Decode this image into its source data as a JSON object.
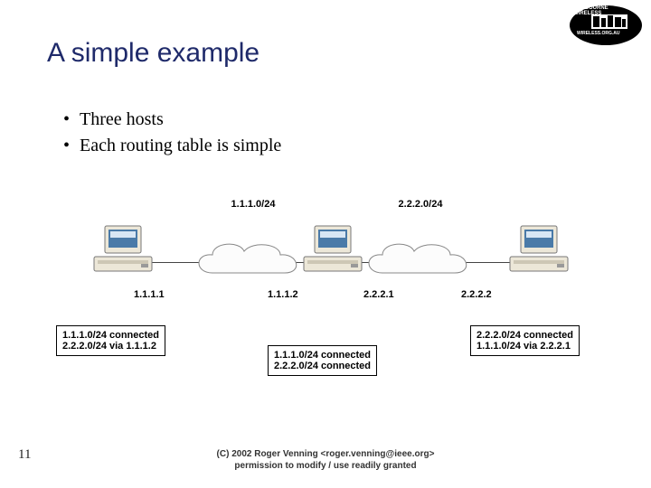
{
  "title": "A simple example",
  "bullets": [
    "Three hosts",
    "Each routing table is simple"
  ],
  "networks": {
    "left": "1.1.1.0/24",
    "right": "2.2.2.0/24"
  },
  "hosts": {
    "a": {
      "ip": "1.1.1.1",
      "route1": "1.1.1.0/24 connected",
      "route2": "2.2.2.0/24 via 1.1.1.2"
    },
    "b": {
      "ip_left": "1.1.1.2",
      "ip_right": "2.2.2.1",
      "route1": "1.1.1.0/24  connected",
      "route2": "2.2.2.0/24  connected"
    },
    "c": {
      "ip": "2.2.2.2",
      "route1": "2.2.2.0/24 connected",
      "route2": "1.1.1.0/24 via 2.2.2.1"
    }
  },
  "footer": {
    "line1": "(C) 2002 Roger Venning <roger.venning@ieee.org>",
    "line2": "permission to modify / use readily granted"
  },
  "page_number": "11",
  "logo": {
    "line1": "MELBOURNE",
    "line2": "WIRELESS",
    "line3": "WIRELESS.ORG.AU"
  }
}
